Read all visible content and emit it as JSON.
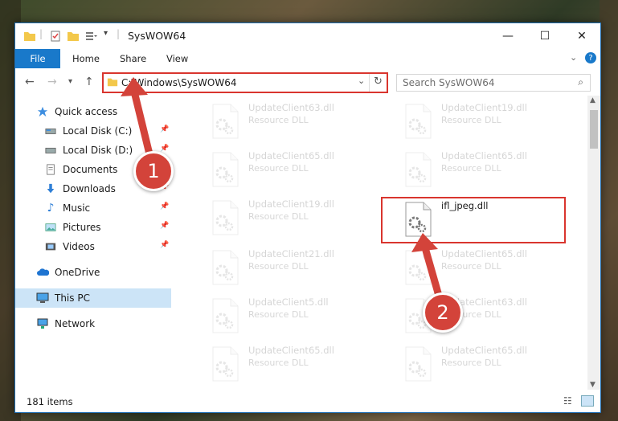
{
  "window": {
    "title": "SysWOW64"
  },
  "ribbon": {
    "tabs": [
      "File",
      "Home",
      "Share",
      "View"
    ]
  },
  "address": {
    "path": "C:\\Windows\\SysWOW64"
  },
  "search": {
    "placeholder": "Search SysWOW64"
  },
  "sidebar": {
    "items": [
      {
        "label": "Quick access",
        "icon": "star-icon"
      },
      {
        "label": "Local Disk (C:)",
        "icon": "drive-icon",
        "pinned": true
      },
      {
        "label": "Local Disk (D:)",
        "icon": "drive-icon",
        "pinned": true
      },
      {
        "label": "Documents",
        "icon": "document-icon",
        "pinned": true
      },
      {
        "label": "Downloads",
        "icon": "download-icon",
        "pinned": true
      },
      {
        "label": "Music",
        "icon": "music-icon",
        "pinned": true
      },
      {
        "label": "Pictures",
        "icon": "pictures-icon",
        "pinned": true
      },
      {
        "label": "Videos",
        "icon": "videos-icon",
        "pinned": true
      },
      {
        "label": "OneDrive",
        "icon": "cloud-icon"
      },
      {
        "label": "This PC",
        "icon": "computer-icon",
        "selected": true
      },
      {
        "label": "Network",
        "icon": "network-icon"
      }
    ]
  },
  "files": [
    {
      "name": "UpdateClient63.dll",
      "type": "Resource DLL"
    },
    {
      "name": "UpdateClient19.dll",
      "type": "Resource DLL"
    },
    {
      "name": "UpdateClient65.dll",
      "type": "Resource DLL"
    },
    {
      "name": "UpdateClient65.dll",
      "type": "Resource DLL"
    },
    {
      "name": "UpdateClient19.dll",
      "type": "Resource DLL"
    },
    {
      "name": "ifl_jpeg.dll",
      "type": "",
      "highlighted": true
    },
    {
      "name": "UpdateClient21.dll",
      "type": "Resource DLL"
    },
    {
      "name": "UpdateClient65.dll",
      "type": "Resource DLL"
    },
    {
      "name": "UpdateClient5.dll",
      "type": "Resource DLL"
    },
    {
      "name": "UpdateClient63.dll",
      "type": "Resource DLL"
    },
    {
      "name": "UpdateClient65.dll",
      "type": "Resource DLL"
    },
    {
      "name": "UpdateClient65.dll",
      "type": "Resource DLL"
    }
  ],
  "status": {
    "count": "181 items"
  },
  "callouts": [
    "1",
    "2"
  ],
  "colors": {
    "accent": "#1979ca",
    "highlight": "#d9352e",
    "selected": "#cce4f7"
  }
}
